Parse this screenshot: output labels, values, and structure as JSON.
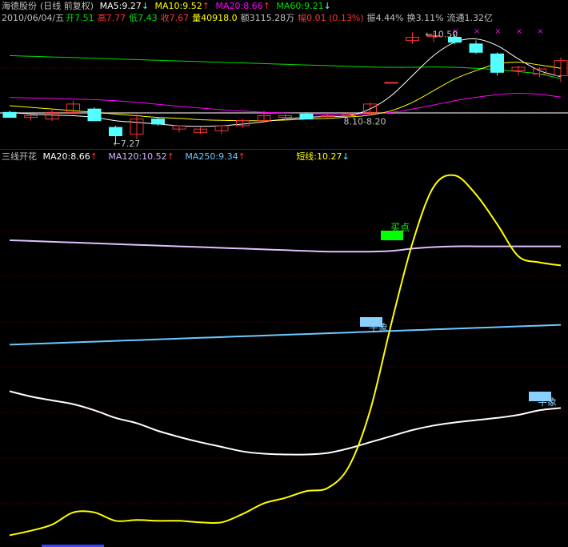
{
  "header": {
    "stock_name": "海德股份",
    "period_label": "(日线 前复权)",
    "ma5": "MA5:9.27",
    "ma10": "MA10:9.52",
    "ma20": "MA20:8.66",
    "ma60": "MA60:9.21",
    "up_arrow": "↑",
    "down_arrow": "↓",
    "date": "2010/06/04/五",
    "open_label": "开",
    "open_value": "7.51",
    "high_label": "高",
    "high_value": "7.77",
    "low_label": "低",
    "low_value": "7.43",
    "close_label": "收",
    "close_value": "7.67",
    "volume_label": "量",
    "volume_value": "40918.0",
    "amount_label": "额",
    "amount_value": "3115.28万",
    "change_label": "幅",
    "change_value": "0.01 (0.13%)",
    "amplitude_label": "振",
    "amplitude_value": "4.44%",
    "turnover_label": "换",
    "turnover_value": "3.11%",
    "float_label": "流通",
    "float_value": "1.32亿"
  },
  "indicator_header": {
    "name": "三线开花",
    "ma20": "MA20:8.66",
    "ma120": "MA120:10.52",
    "ma250": "MA250:9.34",
    "short": "短线:10.27",
    "up_arrow": "↑",
    "down_arrow": "↓"
  },
  "colors": {
    "up": "#ff3232",
    "down": "#54ffff",
    "ma5": "#ffffff",
    "ma10": "#ffff00",
    "ma20": "#ff00ff",
    "ma60": "#00e000",
    "ma120": "#e0c0ff",
    "ma250": "#6cc8ff",
    "short": "#ffff00",
    "buy_label": "#00ff00",
    "bull_label": "#8ad0ff"
  },
  "chart_data": [
    {
      "type": "candlestick",
      "annotations": {
        "max_price": "10.50",
        "min_price": "7.27",
        "range_note": "8.10-8.20"
      },
      "candles": [
        {
          "o": 8.2,
          "h": 8.25,
          "l": 8.05,
          "c": 8.05
        },
        {
          "o": 8.05,
          "h": 8.15,
          "l": 7.95,
          "c": 8.1
        },
        {
          "o": 8.0,
          "h": 8.3,
          "l": 7.95,
          "c": 8.2
        },
        {
          "o": 8.2,
          "h": 8.55,
          "l": 8.15,
          "c": 8.45
        },
        {
          "o": 8.3,
          "h": 8.35,
          "l": 7.95,
          "c": 7.95
        },
        {
          "o": 7.75,
          "h": 7.8,
          "l": 7.27,
          "c": 7.5
        },
        {
          "o": 7.55,
          "h": 8.15,
          "l": 7.4,
          "c": 8.0
        },
        {
          "o": 8.0,
          "h": 8.05,
          "l": 7.8,
          "c": 7.85
        },
        {
          "o": 7.7,
          "h": 7.8,
          "l": 7.6,
          "c": 7.8
        },
        {
          "o": 7.6,
          "h": 7.75,
          "l": 7.55,
          "c": 7.7
        },
        {
          "o": 7.65,
          "h": 7.8,
          "l": 7.55,
          "c": 7.8
        },
        {
          "o": 7.8,
          "h": 8.0,
          "l": 7.75,
          "c": 7.95
        },
        {
          "o": 7.95,
          "h": 8.25,
          "l": 7.9,
          "c": 8.1
        },
        {
          "o": 8.05,
          "h": 8.15,
          "l": 7.95,
          "c": 8.1
        },
        {
          "o": 8.15,
          "h": 8.2,
          "l": 8.0,
          "c": 8.0
        },
        {
          "o": 8.1,
          "h": 8.15,
          "l": 8.05,
          "c": 8.1
        },
        {
          "o": 8.1,
          "h": 8.2,
          "l": 8.05,
          "c": 8.15
        },
        {
          "o": 8.2,
          "h": 8.5,
          "l": 8.15,
          "c": 8.45
        },
        {
          "o": 9.1,
          "h": 9.1,
          "l": 9.1,
          "c": 9.1
        },
        {
          "o": 10.35,
          "h": 10.6,
          "l": 10.25,
          "c": 10.45
        },
        {
          "o": 10.5,
          "h": 10.6,
          "l": 10.3,
          "c": 10.5
        },
        {
          "o": 10.45,
          "h": 10.55,
          "l": 10.25,
          "c": 10.3
        },
        {
          "o": 10.25,
          "h": 10.35,
          "l": 9.95,
          "c": 10.0
        },
        {
          "o": 9.95,
          "h": 10.0,
          "l": 9.3,
          "c": 9.4
        },
        {
          "o": 9.45,
          "h": 9.6,
          "l": 9.3,
          "c": 9.55
        },
        {
          "o": 9.35,
          "h": 9.55,
          "l": 9.25,
          "c": 9.5
        },
        {
          "o": 9.3,
          "h": 9.85,
          "l": 9.1,
          "c": 9.75
        }
      ],
      "series": [
        {
          "name": "MA60",
          "values": [
            9.9,
            9.88,
            9.86,
            9.84,
            9.82,
            9.8,
            9.78,
            9.76,
            9.74,
            9.72,
            9.7,
            9.68,
            9.66,
            9.64,
            9.62,
            9.6,
            9.58,
            9.56,
            9.55,
            9.55,
            9.56,
            9.55,
            9.52,
            9.48,
            9.42,
            9.35,
            9.21
          ]
        },
        {
          "name": "MA20",
          "values": [
            8.65,
            8.63,
            8.62,
            8.6,
            8.58,
            8.55,
            8.5,
            8.44,
            8.38,
            8.33,
            8.28,
            8.24,
            8.2,
            8.18,
            8.16,
            8.14,
            8.14,
            8.16,
            8.2,
            8.3,
            8.42,
            8.55,
            8.65,
            8.73,
            8.77,
            8.74,
            8.66
          ]
        },
        {
          "name": "MA10",
          "values": [
            8.4,
            8.35,
            8.3,
            8.25,
            8.2,
            8.15,
            8.1,
            8.05,
            8.02,
            7.98,
            7.96,
            7.95,
            7.95,
            7.97,
            8.0,
            8.02,
            8.06,
            8.12,
            8.25,
            8.5,
            8.85,
            9.2,
            9.45,
            9.65,
            9.7,
            9.62,
            9.52
          ]
        },
        {
          "name": "MA5",
          "values": [
            8.2,
            8.15,
            8.12,
            8.1,
            8.05,
            7.95,
            7.9,
            7.85,
            7.8,
            7.78,
            7.8,
            7.85,
            7.92,
            8.0,
            8.05,
            8.08,
            8.1,
            8.3,
            8.7,
            9.3,
            9.9,
            10.3,
            10.4,
            10.2,
            9.8,
            9.45,
            9.27
          ]
        }
      ],
      "ylim": [
        7.2,
        10.75
      ]
    },
    {
      "type": "line",
      "labels": {
        "buy": "买点",
        "bull1": "牛象",
        "bull2": "牛象"
      },
      "series": [
        {
          "name": "MA120",
          "values": [
            10.95,
            10.94,
            10.93,
            10.92,
            10.91,
            10.9,
            10.89,
            10.88,
            10.87,
            10.86,
            10.85,
            10.84,
            10.83,
            10.82,
            10.81,
            10.8,
            10.8,
            10.8,
            10.81,
            10.84,
            10.86,
            10.87,
            10.87,
            10.87,
            10.87,
            10.87,
            10.87
          ]
        },
        {
          "name": "MA250",
          "values": [
            9.58,
            9.59,
            9.6,
            9.61,
            9.62,
            9.63,
            9.64,
            9.65,
            9.66,
            9.67,
            9.68,
            9.69,
            9.7,
            9.71,
            9.72,
            9.73,
            9.74,
            9.75,
            9.76,
            9.77,
            9.78,
            9.79,
            9.8,
            9.81,
            9.82,
            9.83,
            9.84
          ]
        },
        {
          "name": "MA20",
          "values": [
            8.97,
            8.9,
            8.85,
            8.8,
            8.72,
            8.62,
            8.55,
            8.45,
            8.37,
            8.3,
            8.24,
            8.18,
            8.15,
            8.14,
            8.14,
            8.16,
            8.22,
            8.3,
            8.38,
            8.46,
            8.52,
            8.56,
            8.59,
            8.62,
            8.66,
            8.72,
            8.75
          ]
        },
        {
          "name": "短线",
          "values": [
            7.08,
            7.14,
            7.22,
            7.38,
            7.38,
            7.27,
            7.28,
            7.27,
            7.27,
            7.25,
            7.25,
            7.36,
            7.5,
            7.57,
            7.66,
            7.7,
            7.98,
            8.71,
            9.85,
            10.91,
            11.65,
            11.8,
            11.55,
            11.16,
            10.74,
            10.66,
            10.62
          ]
        }
      ],
      "ylim": [
        7.0,
        12.0
      ]
    }
  ]
}
